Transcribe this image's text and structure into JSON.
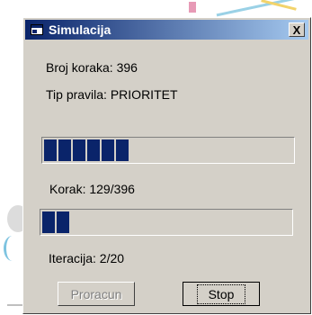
{
  "window": {
    "title": "Simulacija",
    "close_label": "X"
  },
  "info": {
    "steps_label": "Broj koraka:  396",
    "rule_label": "Tip pravila: PRIORITET"
  },
  "progress_steps": {
    "label": "Korak: 129/396",
    "current": 129,
    "total": 396
  },
  "progress_iterations": {
    "label": "Iteracija: 2/20",
    "current": 2,
    "total": 20
  },
  "buttons": {
    "compute_label": "Proracun",
    "compute_enabled": false,
    "stop_label": "Stop"
  }
}
